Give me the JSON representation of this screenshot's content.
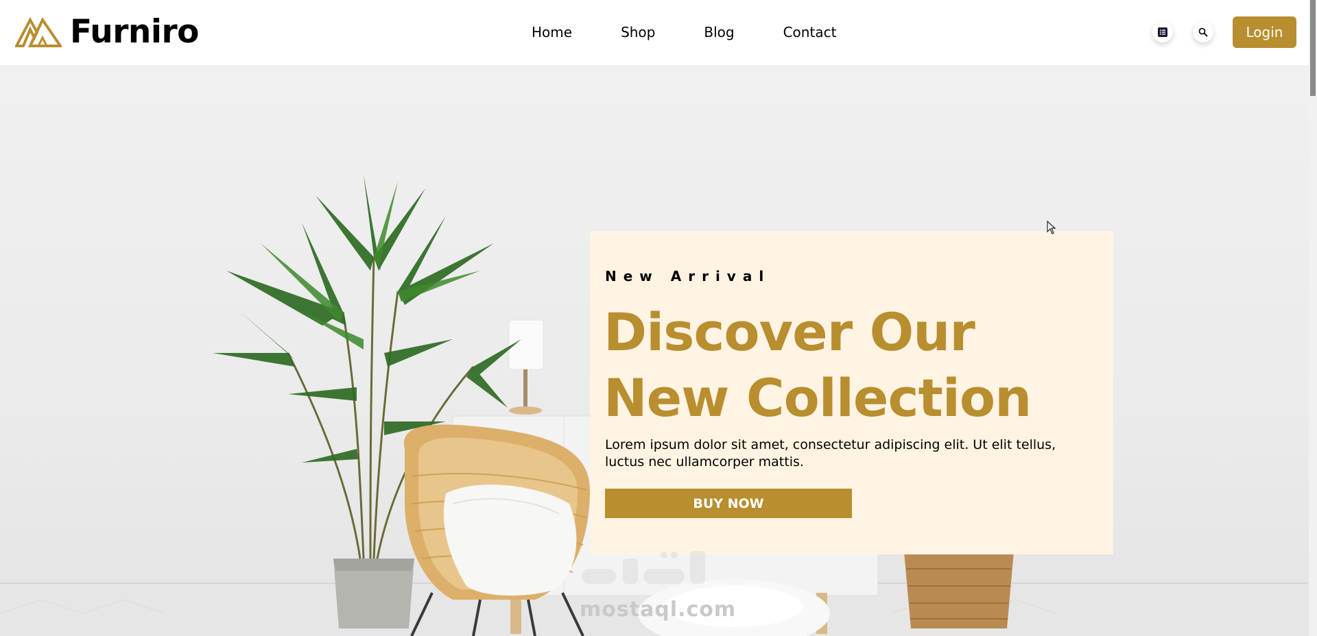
{
  "brand": {
    "name": "Furniro",
    "accent": "#B88E2F",
    "card_bg": "#FFF3E3"
  },
  "nav": {
    "items": [
      "Home",
      "Shop",
      "Blog",
      "Contact"
    ]
  },
  "header_actions": {
    "menu_icon": "list-icon",
    "search_icon": "search-icon",
    "login_label": "Login"
  },
  "hero": {
    "eyebrow": "New Arrival",
    "headline_line1": "Discover Our",
    "headline_line2": "New Collection",
    "description": "Lorem ipsum dolor sit amet, consectetur adipiscing elit. Ut elit tellus, luctus nec ullamcorper mattis.",
    "cta_label": "BUY NOW"
  },
  "watermark": {
    "site": "mostaql.com"
  }
}
